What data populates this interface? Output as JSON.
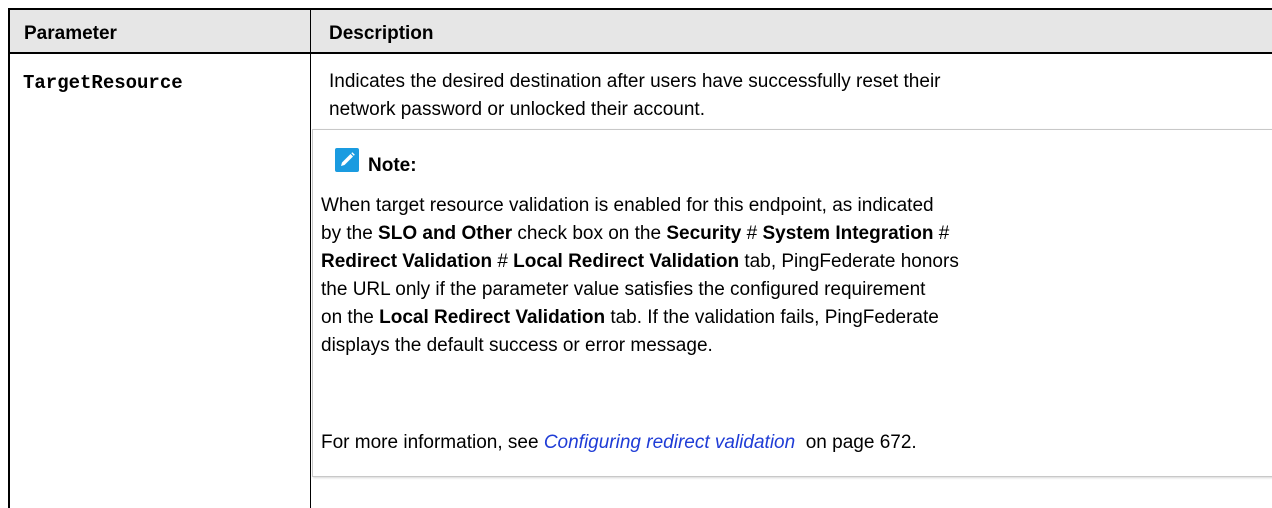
{
  "table": {
    "headers": {
      "parameter": "Parameter",
      "description": "Description"
    },
    "row": {
      "parameter": "TargetResource",
      "description_line1": "Indicates the desired destination after users have successfully reset their",
      "description_line2": "network password or unlocked their account."
    }
  },
  "note": {
    "icon": "pencil-icon",
    "icon_color": "#1a9be0",
    "title": "Note:",
    "body": {
      "line1": "When target resource validation is enabled for this endpoint, as indicated",
      "line2_a": "by the ",
      "line2_b": "SLO and Other",
      "line2_c": " check box on the ",
      "line2_d": "Security",
      "line2_e": " # ",
      "line2_f": "System Integration",
      "line2_g": " #",
      "line3_a": "Redirect Validation",
      "line3_b": " # ",
      "line3_c": "Local Redirect Validation",
      "line3_d": " tab, PingFederate honors",
      "line4": "the URL only if the parameter value satisfies the configured requirement",
      "line5_a": "on the ",
      "line5_b": "Local Redirect Validation",
      "line5_c": " tab. If the validation fails, PingFederate",
      "line6": "displays the default success or error message."
    },
    "more": {
      "prefix": "For more information, see ",
      "link": "Configuring redirect validation",
      "suffix": "  on page 672."
    }
  }
}
